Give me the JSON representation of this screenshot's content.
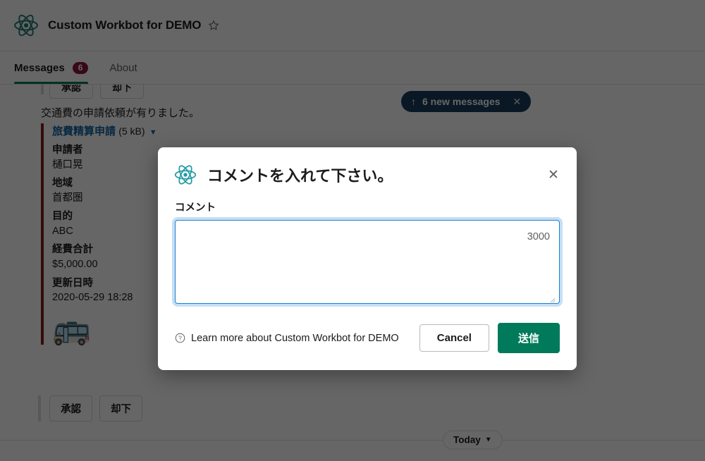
{
  "header": {
    "logo_icon": "atom-icon",
    "title": "Custom Workbot for DEMO",
    "star_icon": "star-icon"
  },
  "tabs": [
    {
      "label": "Messages",
      "badge": "6",
      "active": true
    },
    {
      "label": "About",
      "badge": "",
      "active": false
    }
  ],
  "new_messages_banner": {
    "arrow_icon": "arrow-up-icon",
    "label": "6 new messages",
    "close_icon": "close-icon"
  },
  "message": {
    "cut_buttons": [
      "承認",
      "却下"
    ],
    "body_text": "交通費の申請依頼が有りました。",
    "attachment": {
      "title": "旅費精算申請",
      "size": "(5 kB)",
      "caret_icon": "caret-down-icon",
      "accent_color": "#8b1d1d",
      "fields": [
        {
          "label": "申請者",
          "value": "樋口晃"
        },
        {
          "label": "地域",
          "value": "首都圏"
        },
        {
          "label": "目的",
          "value": "ABC"
        },
        {
          "label": "経費合計",
          "value": "$5,000.00"
        },
        {
          "label": "更新日時",
          "value": "2020-05-29 18:28"
        }
      ],
      "emoji": "🚌"
    },
    "actions": [
      {
        "label": "承認"
      },
      {
        "label": "却下"
      }
    ]
  },
  "day_divider": {
    "label": "Today",
    "chevron_icon": "chevron-down-icon"
  },
  "modal": {
    "icon": "atom-icon",
    "title": "コメントを入れて下さい。",
    "close_icon": "close-icon",
    "field_label": "コメント",
    "textarea_value": "",
    "textarea_placeholder": "",
    "char_counter": "3000",
    "help_icon": "question-circle-icon",
    "learn_more": "Learn more about Custom Workbot for DEMO",
    "cancel_label": "Cancel",
    "submit_label": "送信"
  },
  "colors": {
    "brand_teal": "#1f9aa3",
    "slack_green": "#007a5a",
    "badge_maroon": "#8c1542",
    "link_blue": "#1264a3",
    "focus_blue": "#1d7fd4",
    "banner_navy": "#1a3d5c",
    "attachment_accent": "#8b1d1d"
  }
}
